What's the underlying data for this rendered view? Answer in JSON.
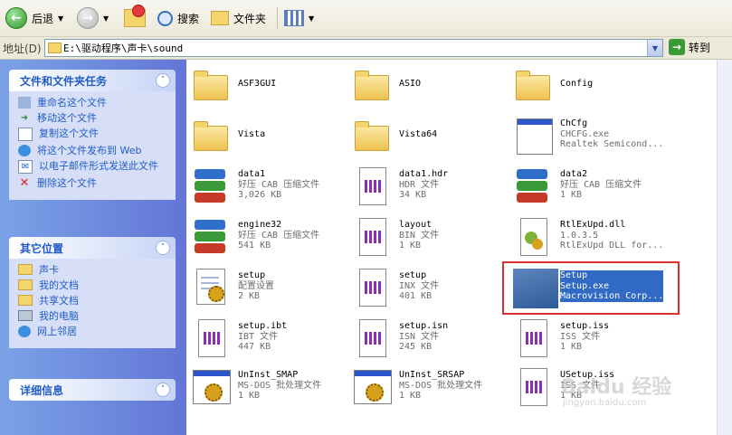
{
  "toolbar": {
    "back_label": "后退",
    "search_label": "搜索",
    "folders_label": "文件夹"
  },
  "address": {
    "label": "地址(D)",
    "path": "E:\\驱动程序\\声卡\\sound",
    "go_label": "转到"
  },
  "tasks_panel": {
    "title": "文件和文件夹任务",
    "items": [
      {
        "label": "重命名这个文件",
        "icon": "rename-icon"
      },
      {
        "label": "移动这个文件",
        "icon": "move-icon"
      },
      {
        "label": "复制这个文件",
        "icon": "copy-icon"
      },
      {
        "label": "将这个文件发布到 Web",
        "icon": "publish-web-icon"
      },
      {
        "label": "以电子邮件形式发送此文件",
        "icon": "email-icon"
      },
      {
        "label": "删除这个文件",
        "icon": "delete-icon"
      }
    ]
  },
  "other_panel": {
    "title": "其它位置",
    "items": [
      {
        "label": "声卡",
        "icon": "folder-icon"
      },
      {
        "label": "我的文档",
        "icon": "my-documents-icon"
      },
      {
        "label": "共享文档",
        "icon": "shared-documents-icon"
      },
      {
        "label": "我的电脑",
        "icon": "my-computer-icon"
      },
      {
        "label": "网上邻居",
        "icon": "network-icon"
      }
    ]
  },
  "details_panel": {
    "title": "详细信息"
  },
  "files": [
    {
      "name": "ASF3GUI",
      "line2": "",
      "line3": "",
      "icon": "folder-icon"
    },
    {
      "name": "ASIO",
      "line2": "",
      "line3": "",
      "icon": "folder-icon"
    },
    {
      "name": "Config",
      "line2": "",
      "line3": "",
      "icon": "folder-icon"
    },
    {
      "name": "Vista",
      "line2": "",
      "line3": "",
      "icon": "folder-icon"
    },
    {
      "name": "Vista64",
      "line2": "",
      "line3": "",
      "icon": "folder-icon"
    },
    {
      "name": "ChCfg",
      "line2": "CHCFG.exe",
      "line3": "Realtek Semicond...",
      "icon": "application-icon"
    },
    {
      "name": "data1",
      "line2": "好压 CAB 压缩文件",
      "line3": "3,026 KB",
      "icon": "cab-archive-icon"
    },
    {
      "name": "data1.hdr",
      "line2": "HDR 文件",
      "line3": "34 KB",
      "icon": "generic-file-icon"
    },
    {
      "name": "data2",
      "line2": "好压 CAB 压缩文件",
      "line3": "1 KB",
      "icon": "cab-archive-icon"
    },
    {
      "name": "engine32",
      "line2": "好压 CAB 压缩文件",
      "line3": "541 KB",
      "icon": "cab-archive-icon"
    },
    {
      "name": "layout",
      "line2": "BIN 文件",
      "line3": "1 KB",
      "icon": "generic-file-icon"
    },
    {
      "name": "RtlExUpd.dll",
      "line2": "1.0.3.5",
      "line3": "RtlExUpd DLL for...",
      "icon": "dll-icon"
    },
    {
      "name": "setup",
      "line2": "配置设置",
      "line3": "2 KB",
      "icon": "config-settings-icon"
    },
    {
      "name": "setup",
      "line2": "INX 文件",
      "line3": "401 KB",
      "icon": "generic-file-icon"
    },
    {
      "name": "Setup",
      "line2": "Setup.exe",
      "line3": "Macrovision Corp...",
      "icon": "setup-exe-icon"
    },
    {
      "name": "setup.ibt",
      "line2": "IBT 文件",
      "line3": "447 KB",
      "icon": "generic-file-icon"
    },
    {
      "name": "setup.isn",
      "line2": "ISN 文件",
      "line3": "245 KB",
      "icon": "generic-file-icon"
    },
    {
      "name": "setup.iss",
      "line2": "ISS 文件",
      "line3": "1 KB",
      "icon": "generic-file-icon"
    },
    {
      "name": "UnInst_SMAP",
      "line2": "MS-DOS 批处理文件",
      "line3": "1 KB",
      "icon": "batch-file-icon"
    },
    {
      "name": "UnInst_SRSAP",
      "line2": "MS-DOS 批处理文件",
      "line3": "1 KB",
      "icon": "batch-file-icon"
    },
    {
      "name": "USetup.iss",
      "line2": "ISS 文件",
      "line3": "1 KB",
      "icon": "generic-file-icon"
    }
  ],
  "selected_file": "Setup",
  "watermark": {
    "text": "Baidu 经验",
    "sub": "jingyan.baidu.com"
  },
  "colors": {
    "selection": "#316ac5",
    "highlight_box": "#e03030",
    "task_link": "#215dc6"
  }
}
